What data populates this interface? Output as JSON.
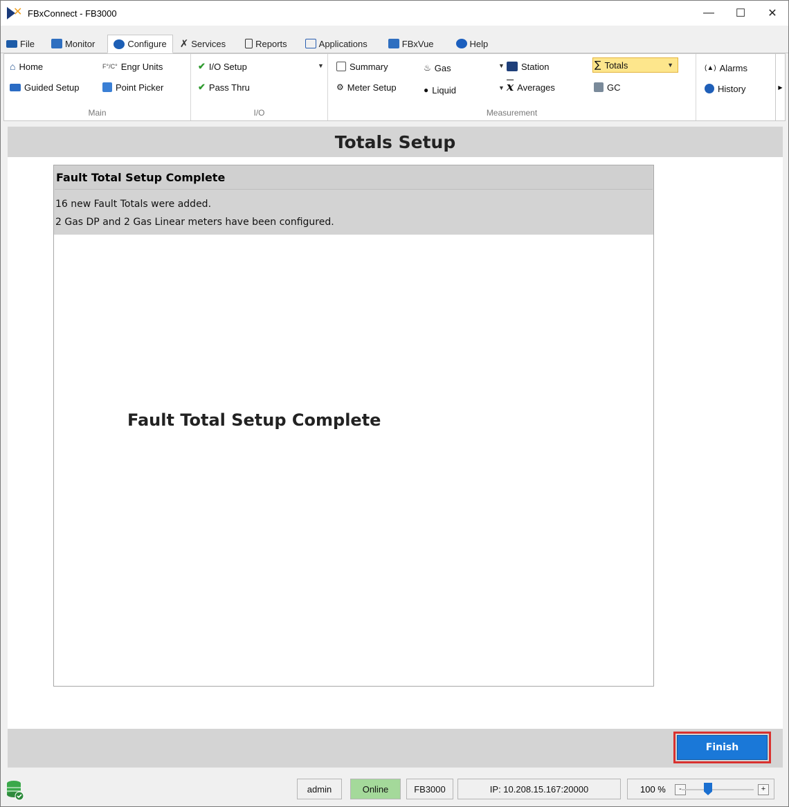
{
  "window": {
    "title": "FBxConnect - FB3000",
    "controls": [
      "minimize",
      "maximize",
      "close"
    ]
  },
  "tabs": [
    {
      "label": "File",
      "icon": "folder-icon"
    },
    {
      "label": "Monitor",
      "icon": "monitor-icon"
    },
    {
      "label": "Configure",
      "icon": "gear-icon",
      "active": true
    },
    {
      "label": "Services",
      "icon": "wrench-icon"
    },
    {
      "label": "Reports",
      "icon": "document-icon"
    },
    {
      "label": "Applications",
      "icon": "applications-icon"
    },
    {
      "label": "FBxVue",
      "icon": "fbxvue-icon"
    },
    {
      "label": "Help",
      "icon": "help-icon"
    }
  ],
  "ribbon": {
    "main": {
      "label": "Main",
      "home": "Home",
      "engr_units": "Engr Units",
      "engr_prefix": "F°/C°",
      "guided_setup": "Guided Setup",
      "point_picker": "Point Picker"
    },
    "io": {
      "label": "I/O",
      "io_setup": "I/O Setup",
      "pass_thru": "Pass Thru"
    },
    "measurement": {
      "label": "Measurement",
      "summary": "Summary",
      "meter_setup": "Meter Setup",
      "gas": "Gas",
      "liquid": "Liquid",
      "station": "Station",
      "averages": "Averages",
      "totals": "Totals",
      "gc": "GC"
    },
    "other": {
      "alarms": "Alarms",
      "history": "History"
    }
  },
  "page": {
    "title": "Totals Setup"
  },
  "panel": {
    "title": "Fault Total Setup Complete",
    "message_lines": [
      "16 new Fault Totals were added.",
      "2 Gas DP and 2 Gas Linear meters have been configured."
    ],
    "big_message": "Fault Total Setup Complete"
  },
  "footer": {
    "finish_label": "Finish"
  },
  "status": {
    "user": "admin",
    "connection": "Online",
    "device": "FB3000",
    "ip": "IP: 10.208.15.167:20000",
    "zoom": "100 %",
    "zoom_minus": "-",
    "zoom_plus": "+"
  },
  "colors": {
    "accent": "#1a78d8",
    "highlight_border": "#d9312f",
    "online": "#a4d99a",
    "totals_selected": "#fde68c"
  }
}
